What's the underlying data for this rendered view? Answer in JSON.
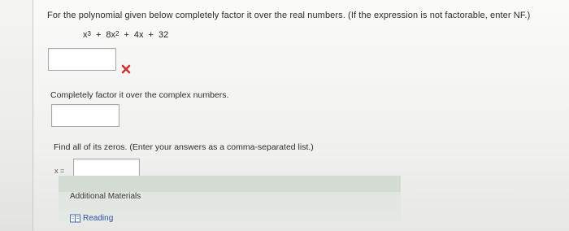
{
  "question": {
    "text": "For the polynomial given below completely factor it over the real numbers. (If the expression is not factorable, enter NF.)",
    "polynomial": {
      "t1_base": "x",
      "t1_exp": "3",
      "op1": "+",
      "t2_base": "8x",
      "t2_exp": "2",
      "op2": "+",
      "t3": "4x",
      "op3": "+",
      "t4": "32"
    }
  },
  "part_real": {
    "answer_value": "",
    "status_icon": "x-mark-icon",
    "status_color": "#cc3333"
  },
  "part_complex": {
    "prompt": "Completely factor it over the complex numbers.",
    "answer_value": ""
  },
  "part_zeros": {
    "prompt": "Find all of its zeros. (Enter your answers as a comma-separated list.)",
    "variable_label": "x =",
    "answer_value": ""
  },
  "additional_materials": {
    "title": "Additional Materials",
    "reading_label": "Reading",
    "reading_icon": "book-icon",
    "link_color": "#2d4fa0"
  }
}
